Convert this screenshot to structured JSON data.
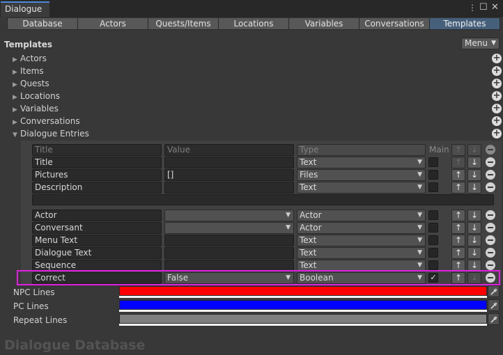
{
  "window": {
    "title": "Dialogue"
  },
  "toolbar": {
    "tabs": [
      "Database",
      "Actors",
      "Quests/Items",
      "Locations",
      "Variables",
      "Conversations",
      "Templates"
    ],
    "active": "Templates"
  },
  "section": {
    "title": "Templates",
    "menu_label": "Menu"
  },
  "foldouts": [
    "Actors",
    "Items",
    "Quests",
    "Locations",
    "Variables",
    "Conversations",
    "Dialogue Entries"
  ],
  "table": {
    "header": {
      "title": "Title",
      "value": "Value",
      "type": "Type",
      "main": "Main"
    },
    "rows_top": [
      {
        "title": "Title",
        "value": "",
        "type": "Text"
      },
      {
        "title": "Pictures",
        "value": "[]",
        "type": "Files"
      },
      {
        "title": "Description",
        "value": "",
        "type": "Text"
      }
    ],
    "rows_bottom": [
      {
        "title": "Actor",
        "value": "",
        "type": "Actor"
      },
      {
        "title": "Conversant",
        "value": "",
        "type": "Actor"
      },
      {
        "title": "Menu Text",
        "value": "",
        "type": "Text"
      },
      {
        "title": "Dialogue Text",
        "value": "",
        "type": "Text"
      },
      {
        "title": "Sequence",
        "value": "",
        "type": "Text"
      },
      {
        "title": "Correct",
        "value": "False",
        "type": "Boolean"
      }
    ],
    "checkmark": "✓",
    "arrow_up": "↑",
    "arrow_down": "↓"
  },
  "colors_section": [
    {
      "label": "NPC Lines",
      "color": "#ff0000"
    },
    {
      "label": "PC Lines",
      "color": "#0000ff"
    },
    {
      "label": "Repeat Lines",
      "color": "#7f7f7f"
    }
  ],
  "footer": {
    "title": "Dialogue Database"
  },
  "highlight_color": "#e020e0"
}
